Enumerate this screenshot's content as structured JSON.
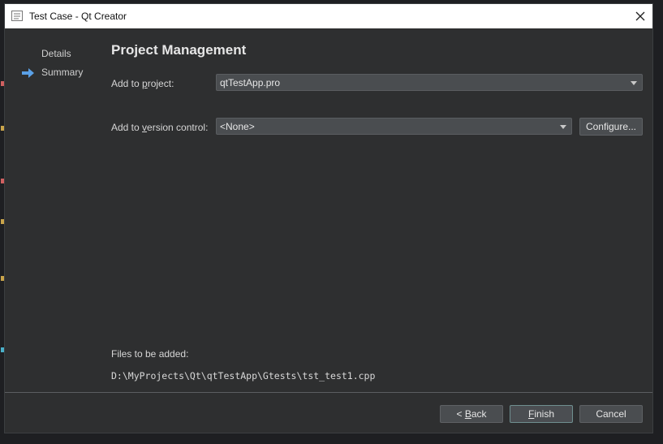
{
  "window": {
    "title": "Test Case - Qt Creator"
  },
  "sidebar": {
    "items": [
      {
        "label": "Details",
        "active": false
      },
      {
        "label": "Summary",
        "active": true
      }
    ]
  },
  "page": {
    "title": "Project Management"
  },
  "form": {
    "project_label_pre": "Add to ",
    "project_label_accel": "p",
    "project_label_post": "roject:",
    "project_value": "qtTestApp.pro",
    "vcs_label_pre": "Add to ",
    "vcs_label_accel": "v",
    "vcs_label_post": "ersion control:",
    "vcs_value": "<None>",
    "configure_label": "Configure..."
  },
  "files": {
    "heading": "Files to be added:",
    "paths": [
      "D:\\MyProjects\\Qt\\qtTestApp\\Gtests\\tst_test1.cpp"
    ]
  },
  "buttons": {
    "back_pre": "< ",
    "back_accel": "B",
    "back_post": "ack",
    "finish_accel": "F",
    "finish_post": "inish",
    "cancel": "Cancel"
  },
  "colors": {
    "dialog_bg": "#2e2f30",
    "accent_arrow": "#5aa0e6"
  }
}
